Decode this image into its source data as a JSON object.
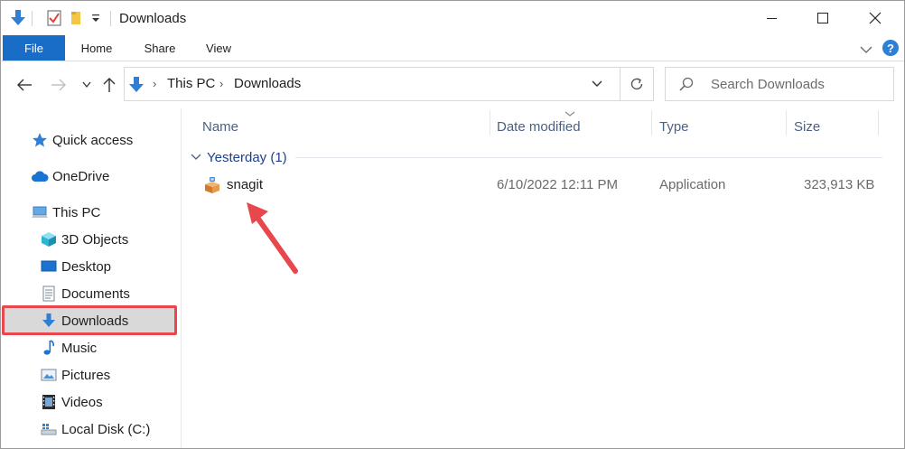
{
  "window": {
    "title": "Downloads"
  },
  "ribbon": {
    "tabs": [
      "File",
      "Home",
      "Share",
      "View"
    ]
  },
  "address": {
    "crumbs": [
      "This PC",
      "Downloads"
    ]
  },
  "search": {
    "placeholder": "Search Downloads"
  },
  "navpane": {
    "items": [
      {
        "label": "Quick access",
        "icon": "star-icon"
      },
      {
        "label": "OneDrive",
        "icon": "cloud-icon"
      },
      {
        "label": "This PC",
        "icon": "computer-icon"
      },
      {
        "label": "3D Objects",
        "icon": "cube-icon"
      },
      {
        "label": "Desktop",
        "icon": "desktop-icon"
      },
      {
        "label": "Documents",
        "icon": "document-icon"
      },
      {
        "label": "Downloads",
        "icon": "download-arrow-icon",
        "selected": true
      },
      {
        "label": "Music",
        "icon": "music-note-icon"
      },
      {
        "label": "Pictures",
        "icon": "picture-icon"
      },
      {
        "label": "Videos",
        "icon": "film-icon"
      },
      {
        "label": "Local Disk (C:)",
        "icon": "drive-icon"
      }
    ]
  },
  "columns": {
    "name": "Name",
    "date": "Date modified",
    "type": "Type",
    "size": "Size"
  },
  "group": {
    "label": "Yesterday (1)"
  },
  "files": [
    {
      "name": "snagit",
      "date": "6/10/2022 12:11 PM",
      "type": "Application",
      "size": "323,913 KB"
    }
  ],
  "colors": {
    "accent": "#1a6dc7",
    "annotation": "#e8474e",
    "group_header": "#1c3f94",
    "selection": "#d9d9d9"
  }
}
